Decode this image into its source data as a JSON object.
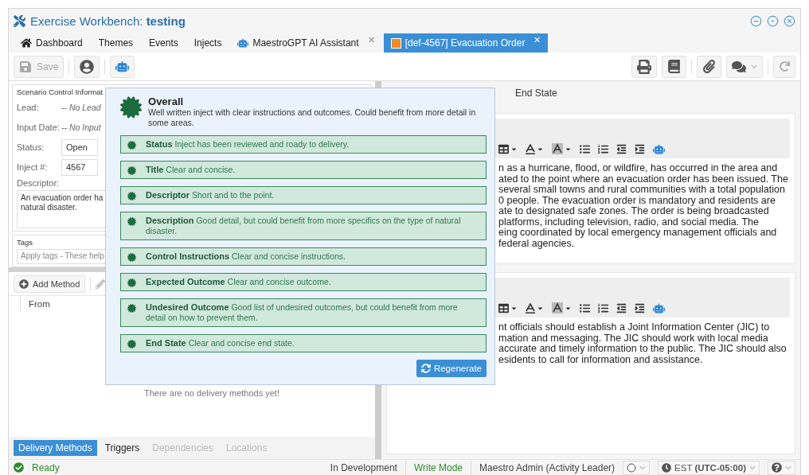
{
  "window": {
    "title_prefix": "Exercise Workbench:",
    "title_name": "testing"
  },
  "tabs": [
    {
      "label": "Dashboard",
      "kind": "home",
      "selected": false,
      "closable": false
    },
    {
      "label": "Themes",
      "kind": "plain",
      "selected": false,
      "closable": false
    },
    {
      "label": "Events",
      "kind": "plain",
      "selected": false,
      "closable": false
    },
    {
      "label": "Injects",
      "kind": "plain",
      "selected": false,
      "closable": false
    },
    {
      "label": "MaestroGPT AI Assistant",
      "kind": "robot",
      "selected": false,
      "closable": true,
      "close": "✕"
    },
    {
      "label": "[def-4567] Evacuation Order",
      "kind": "inject",
      "selected": true,
      "closable": true,
      "close": "✕"
    }
  ],
  "toolbar": {
    "save": {
      "label": "Save",
      "disabled": true
    }
  },
  "info": {
    "legend": "Scenario Control Informat",
    "fields": [
      {
        "label": "Lead:",
        "value": "-- No Lead",
        "kind": "text"
      },
      {
        "label": "Input Date:",
        "value": "-- No Input",
        "kind": "text"
      },
      {
        "label": "Status:",
        "value": "Open",
        "kind": "input"
      },
      {
        "label": "Inject #:",
        "value": "4567",
        "kind": "input"
      }
    ],
    "descriptor_label": "Descriptor:",
    "descriptor_lines": [
      "An evacuation order ha",
      "natural disaster."
    ],
    "tags_legend": "Tags",
    "tags_placeholder": "Apply tags - These help"
  },
  "methods": {
    "add_label": "Add Method",
    "column": "From",
    "empty": "There are no delivery methods yet!"
  },
  "bottom_tabs": [
    {
      "label": "Delivery Methods",
      "selected": true,
      "disabled": false
    },
    {
      "label": "Triggers",
      "selected": false,
      "disabled": false
    },
    {
      "label": "Dependencies",
      "selected": false,
      "disabled": true
    },
    {
      "label": "Locations",
      "selected": false,
      "disabled": true
    }
  ],
  "editor_tab": "End State",
  "editors": [
    {
      "lines": [
        "n as a hurricane, flood, or wildfire, has occurred in the area and",
        "ated to the point where an evacuation order has been issued. The",
        "several small towns and rural communities with a total population",
        "0 people. The evacuation order is mandatory and residents are",
        "ate to designated safe zones. The order is being broadcasted",
        "platforms, including television, radio, and social media. The",
        "eing coordinated by local emergency management officials and",
        "federal agencies."
      ]
    },
    {
      "lines": [
        "nt officials should establish a Joint Information Center (JIC) to",
        "mation and messaging. The JIC should work with local media",
        "accurate and timely information to the public. The JIC should also",
        "esidents to call for information and assistance."
      ]
    }
  ],
  "review": {
    "title": "Overall",
    "summary": "Well written inject with clear instructions and outcomes. Could benefit from more detail in some areas.",
    "items": [
      {
        "label": "Status",
        "text": "Inject has been reviewed and roady to delivery."
      },
      {
        "label": "Title",
        "text": "Clear and concise."
      },
      {
        "label": "Descriptor",
        "text": "Short and to the point."
      },
      {
        "label": "Description",
        "text": "Good detail, but could benefit from more specifics on the type of natural disaster."
      },
      {
        "label": "Control Instructions",
        "text": "Clear and concise instructions."
      },
      {
        "label": "Expected Outcome",
        "text": "Clear and concise outcome."
      },
      {
        "label": "Undesired Outcome",
        "text": "Good list of undesired outcomes, but could benefit from more detail on how to prevent them."
      },
      {
        "label": "End State",
        "text": "Clear and concise end state."
      }
    ],
    "regenerate": "Regenerate"
  },
  "status_bar": {
    "ready": "Ready",
    "stage": "In Development",
    "mode": "Write Mode",
    "user": "Maestro Admin (Activity Leader)",
    "timezone": "EST **(UTC-05:00)**"
  }
}
